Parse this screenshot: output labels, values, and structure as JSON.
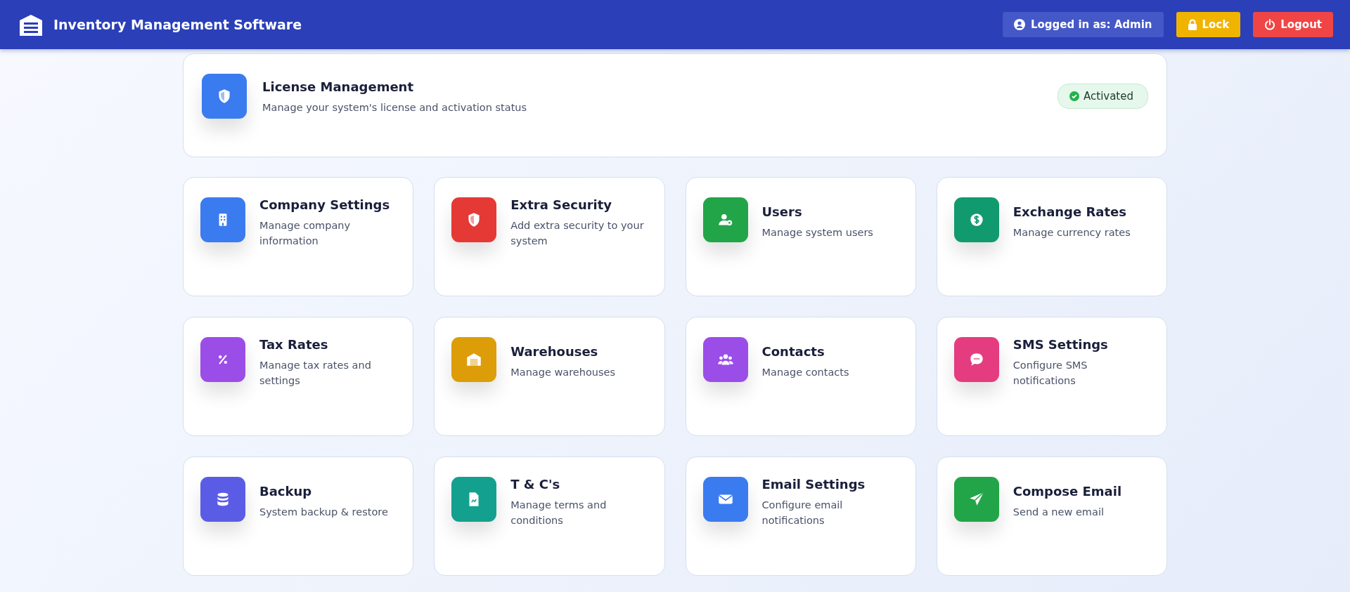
{
  "header": {
    "title": "Inventory Management Software",
    "user_label": "Logged in as: Admin",
    "buttons": [
      {
        "kind": "lock",
        "label": "Lock"
      },
      {
        "kind": "logout",
        "label": "Logout"
      }
    ]
  },
  "license": {
    "title": "License Management",
    "description": "Manage your system's license and activation status",
    "status": "Activated",
    "activated": true
  },
  "cards": [
    {
      "kind": "building",
      "color": "#3b7bf0",
      "title": "Company Settings",
      "description": "Manage company information"
    },
    {
      "kind": "shield",
      "color": "#e53935",
      "title": "Extra Security",
      "description": "Add extra security to your system"
    },
    {
      "kind": "user",
      "color": "#22a548",
      "title": "Users",
      "description": "Manage system users"
    },
    {
      "kind": "dollar",
      "color": "#119a6e",
      "title": "Exchange Rates",
      "description": "Manage currency rates"
    },
    {
      "kind": "percent",
      "color": "#9b4de8",
      "title": "Tax Rates",
      "description": "Manage tax rates and settings"
    },
    {
      "kind": "warehouse",
      "color": "#dc9d08",
      "title": "Warehouses",
      "description": "Manage warehouses"
    },
    {
      "kind": "people",
      "color": "#9b4de8",
      "title": "Contacts",
      "description": "Manage contacts"
    },
    {
      "kind": "sms",
      "color": "#e43c7e",
      "title": "SMS Settings",
      "description": "Configure SMS notifications"
    },
    {
      "kind": "database",
      "color": "#5b5ce6",
      "title": "Backup",
      "description": "System backup & restore"
    },
    {
      "kind": "document",
      "color": "#14a08f",
      "title": "T & C's",
      "description": "Manage terms and conditions"
    },
    {
      "kind": "envelope",
      "color": "#3b7bf0",
      "title": "Email Settings",
      "description": "Configure email notifications"
    },
    {
      "kind": "send",
      "color": "#22a548",
      "title": "Compose Email",
      "description": "Send a new email"
    }
  ]
}
